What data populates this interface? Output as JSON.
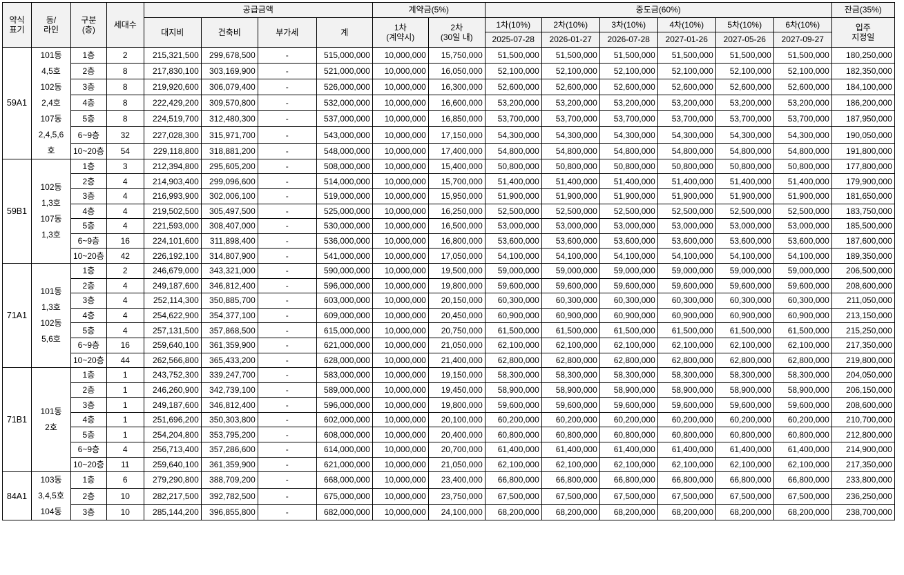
{
  "header": {
    "row1": {
      "type": "약식표기",
      "dong": "동/라인",
      "floor": "구분(층)",
      "units": "세대수",
      "supply": "공급금액",
      "contract": "계약금(5%)",
      "middle": "중도금(60%)",
      "balance": "잔금(35%)"
    },
    "type_lines": [
      "약식",
      "표기"
    ],
    "dong_lines": [
      "동/",
      "라인"
    ],
    "floor_lines": [
      "구분",
      "(층)"
    ],
    "supply_cols": [
      "대지비",
      "건축비",
      "부가세",
      "계"
    ],
    "contract_cols": [
      {
        "label": "1차",
        "sub": "(계약시)"
      },
      {
        "label": "2차",
        "sub": "(30일 내)"
      }
    ],
    "middle_cols": [
      {
        "label": "1차(10%)",
        "date": "2025-07-28"
      },
      {
        "label": "2차(10%)",
        "date": "2026-01-27"
      },
      {
        "label": "3차(10%)",
        "date": "2026-07-28"
      },
      {
        "label": "4차(10%)",
        "date": "2027-01-26"
      },
      {
        "label": "5차(10%)",
        "date": "2027-05-26"
      },
      {
        "label": "6차(10%)",
        "date": "2027-09-27"
      }
    ],
    "balance_col": {
      "label": "입주",
      "sub": "지정일"
    }
  },
  "groups": [
    {
      "type": "59A1",
      "dong": [
        "101동",
        "4,5호",
        "102동",
        "2,4호",
        "107동",
        "2,4,5,6",
        "호"
      ],
      "rows": [
        {
          "floor": "1층",
          "units": "2",
          "land": "215,321,500",
          "build": "299,678,500",
          "vat": "-",
          "total": "515,000,000",
          "c1": "10,000,000",
          "c2": "15,750,000",
          "m": [
            "51,500,000",
            "51,500,000",
            "51,500,000",
            "51,500,000",
            "51,500,000",
            "51,500,000"
          ],
          "bal": "180,250,000"
        },
        {
          "floor": "2층",
          "units": "8",
          "land": "217,830,100",
          "build": "303,169,900",
          "vat": "-",
          "total": "521,000,000",
          "c1": "10,000,000",
          "c2": "16,050,000",
          "m": [
            "52,100,000",
            "52,100,000",
            "52,100,000",
            "52,100,000",
            "52,100,000",
            "52,100,000"
          ],
          "bal": "182,350,000"
        },
        {
          "floor": "3층",
          "units": "8",
          "land": "219,920,600",
          "build": "306,079,400",
          "vat": "-",
          "total": "526,000,000",
          "c1": "10,000,000",
          "c2": "16,300,000",
          "m": [
            "52,600,000",
            "52,600,000",
            "52,600,000",
            "52,600,000",
            "52,600,000",
            "52,600,000"
          ],
          "bal": "184,100,000"
        },
        {
          "floor": "4층",
          "units": "8",
          "land": "222,429,200",
          "build": "309,570,800",
          "vat": "-",
          "total": "532,000,000",
          "c1": "10,000,000",
          "c2": "16,600,000",
          "m": [
            "53,200,000",
            "53,200,000",
            "53,200,000",
            "53,200,000",
            "53,200,000",
            "53,200,000"
          ],
          "bal": "186,200,000"
        },
        {
          "floor": "5층",
          "units": "8",
          "land": "224,519,700",
          "build": "312,480,300",
          "vat": "-",
          "total": "537,000,000",
          "c1": "10,000,000",
          "c2": "16,850,000",
          "m": [
            "53,700,000",
            "53,700,000",
            "53,700,000",
            "53,700,000",
            "53,700,000",
            "53,700,000"
          ],
          "bal": "187,950,000"
        },
        {
          "floor": "6~9층",
          "units": "32",
          "land": "227,028,300",
          "build": "315,971,700",
          "vat": "-",
          "total": "543,000,000",
          "c1": "10,000,000",
          "c2": "17,150,000",
          "m": [
            "54,300,000",
            "54,300,000",
            "54,300,000",
            "54,300,000",
            "54,300,000",
            "54,300,000"
          ],
          "bal": "190,050,000"
        },
        {
          "floor": "10~20층",
          "units": "54",
          "land": "229,118,800",
          "build": "318,881,200",
          "vat": "-",
          "total": "548,000,000",
          "c1": "10,000,000",
          "c2": "17,400,000",
          "m": [
            "54,800,000",
            "54,800,000",
            "54,800,000",
            "54,800,000",
            "54,800,000",
            "54,800,000"
          ],
          "bal": "191,800,000"
        }
      ]
    },
    {
      "type": "59B1",
      "dong": [
        "102동",
        "1,3호",
        "107동",
        "1,3호"
      ],
      "rows": [
        {
          "floor": "1층",
          "units": "3",
          "land": "212,394,800",
          "build": "295,605,200",
          "vat": "-",
          "total": "508,000,000",
          "c1": "10,000,000",
          "c2": "15,400,000",
          "m": [
            "50,800,000",
            "50,800,000",
            "50,800,000",
            "50,800,000",
            "50,800,000",
            "50,800,000"
          ],
          "bal": "177,800,000"
        },
        {
          "floor": "2층",
          "units": "4",
          "land": "214,903,400",
          "build": "299,096,600",
          "vat": "-",
          "total": "514,000,000",
          "c1": "10,000,000",
          "c2": "15,700,000",
          "m": [
            "51,400,000",
            "51,400,000",
            "51,400,000",
            "51,400,000",
            "51,400,000",
            "51,400,000"
          ],
          "bal": "179,900,000"
        },
        {
          "floor": "3층",
          "units": "4",
          "land": "216,993,900",
          "build": "302,006,100",
          "vat": "-",
          "total": "519,000,000",
          "c1": "10,000,000",
          "c2": "15,950,000",
          "m": [
            "51,900,000",
            "51,900,000",
            "51,900,000",
            "51,900,000",
            "51,900,000",
            "51,900,000"
          ],
          "bal": "181,650,000"
        },
        {
          "floor": "4층",
          "units": "4",
          "land": "219,502,500",
          "build": "305,497,500",
          "vat": "-",
          "total": "525,000,000",
          "c1": "10,000,000",
          "c2": "16,250,000",
          "m": [
            "52,500,000",
            "52,500,000",
            "52,500,000",
            "52,500,000",
            "52,500,000",
            "52,500,000"
          ],
          "bal": "183,750,000"
        },
        {
          "floor": "5층",
          "units": "4",
          "land": "221,593,000",
          "build": "308,407,000",
          "vat": "-",
          "total": "530,000,000",
          "c1": "10,000,000",
          "c2": "16,500,000",
          "m": [
            "53,000,000",
            "53,000,000",
            "53,000,000",
            "53,000,000",
            "53,000,000",
            "53,000,000"
          ],
          "bal": "185,500,000"
        },
        {
          "floor": "6~9층",
          "units": "16",
          "land": "224,101,600",
          "build": "311,898,400",
          "vat": "-",
          "total": "536,000,000",
          "c1": "10,000,000",
          "c2": "16,800,000",
          "m": [
            "53,600,000",
            "53,600,000",
            "53,600,000",
            "53,600,000",
            "53,600,000",
            "53,600,000"
          ],
          "bal": "187,600,000"
        },
        {
          "floor": "10~20층",
          "units": "42",
          "land": "226,192,100",
          "build": "314,807,900",
          "vat": "-",
          "total": "541,000,000",
          "c1": "10,000,000",
          "c2": "17,050,000",
          "m": [
            "54,100,000",
            "54,100,000",
            "54,100,000",
            "54,100,000",
            "54,100,000",
            "54,100,000"
          ],
          "bal": "189,350,000"
        }
      ]
    },
    {
      "type": "71A1",
      "dong": [
        "101동",
        "1,3호",
        "102동",
        "5,6호"
      ],
      "rows": [
        {
          "floor": "1층",
          "units": "2",
          "land": "246,679,000",
          "build": "343,321,000",
          "vat": "-",
          "total": "590,000,000",
          "c1": "10,000,000",
          "c2": "19,500,000",
          "m": [
            "59,000,000",
            "59,000,000",
            "59,000,000",
            "59,000,000",
            "59,000,000",
            "59,000,000"
          ],
          "bal": "206,500,000"
        },
        {
          "floor": "2층",
          "units": "4",
          "land": "249,187,600",
          "build": "346,812,400",
          "vat": "-",
          "total": "596,000,000",
          "c1": "10,000,000",
          "c2": "19,800,000",
          "m": [
            "59,600,000",
            "59,600,000",
            "59,600,000",
            "59,600,000",
            "59,600,000",
            "59,600,000"
          ],
          "bal": "208,600,000"
        },
        {
          "floor": "3층",
          "units": "4",
          "land": "252,114,300",
          "build": "350,885,700",
          "vat": "-",
          "total": "603,000,000",
          "c1": "10,000,000",
          "c2": "20,150,000",
          "m": [
            "60,300,000",
            "60,300,000",
            "60,300,000",
            "60,300,000",
            "60,300,000",
            "60,300,000"
          ],
          "bal": "211,050,000"
        },
        {
          "floor": "4층",
          "units": "4",
          "land": "254,622,900",
          "build": "354,377,100",
          "vat": "-",
          "total": "609,000,000",
          "c1": "10,000,000",
          "c2": "20,450,000",
          "m": [
            "60,900,000",
            "60,900,000",
            "60,900,000",
            "60,900,000",
            "60,900,000",
            "60,900,000"
          ],
          "bal": "213,150,000"
        },
        {
          "floor": "5층",
          "units": "4",
          "land": "257,131,500",
          "build": "357,868,500",
          "vat": "-",
          "total": "615,000,000",
          "c1": "10,000,000",
          "c2": "20,750,000",
          "m": [
            "61,500,000",
            "61,500,000",
            "61,500,000",
            "61,500,000",
            "61,500,000",
            "61,500,000"
          ],
          "bal": "215,250,000"
        },
        {
          "floor": "6~9층",
          "units": "16",
          "land": "259,640,100",
          "build": "361,359,900",
          "vat": "-",
          "total": "621,000,000",
          "c1": "10,000,000",
          "c2": "21,050,000",
          "m": [
            "62,100,000",
            "62,100,000",
            "62,100,000",
            "62,100,000",
            "62,100,000",
            "62,100,000"
          ],
          "bal": "217,350,000"
        },
        {
          "floor": "10~20층",
          "units": "44",
          "land": "262,566,800",
          "build": "365,433,200",
          "vat": "-",
          "total": "628,000,000",
          "c1": "10,000,000",
          "c2": "21,400,000",
          "m": [
            "62,800,000",
            "62,800,000",
            "62,800,000",
            "62,800,000",
            "62,800,000",
            "62,800,000"
          ],
          "bal": "219,800,000"
        }
      ]
    },
    {
      "type": "71B1",
      "dong": [
        "101동",
        "2호"
      ],
      "rows": [
        {
          "floor": "1층",
          "units": "1",
          "land": "243,752,300",
          "build": "339,247,700",
          "vat": "-",
          "total": "583,000,000",
          "c1": "10,000,000",
          "c2": "19,150,000",
          "m": [
            "58,300,000",
            "58,300,000",
            "58,300,000",
            "58,300,000",
            "58,300,000",
            "58,300,000"
          ],
          "bal": "204,050,000"
        },
        {
          "floor": "2층",
          "units": "1",
          "land": "246,260,900",
          "build": "342,739,100",
          "vat": "-",
          "total": "589,000,000",
          "c1": "10,000,000",
          "c2": "19,450,000",
          "m": [
            "58,900,000",
            "58,900,000",
            "58,900,000",
            "58,900,000",
            "58,900,000",
            "58,900,000"
          ],
          "bal": "206,150,000"
        },
        {
          "floor": "3층",
          "units": "1",
          "land": "249,187,600",
          "build": "346,812,400",
          "vat": "-",
          "total": "596,000,000",
          "c1": "10,000,000",
          "c2": "19,800,000",
          "m": [
            "59,600,000",
            "59,600,000",
            "59,600,000",
            "59,600,000",
            "59,600,000",
            "59,600,000"
          ],
          "bal": "208,600,000"
        },
        {
          "floor": "4층",
          "units": "1",
          "land": "251,696,200",
          "build": "350,303,800",
          "vat": "-",
          "total": "602,000,000",
          "c1": "10,000,000",
          "c2": "20,100,000",
          "m": [
            "60,200,000",
            "60,200,000",
            "60,200,000",
            "60,200,000",
            "60,200,000",
            "60,200,000"
          ],
          "bal": "210,700,000"
        },
        {
          "floor": "5층",
          "units": "1",
          "land": "254,204,800",
          "build": "353,795,200",
          "vat": "-",
          "total": "608,000,000",
          "c1": "10,000,000",
          "c2": "20,400,000",
          "m": [
            "60,800,000",
            "60,800,000",
            "60,800,000",
            "60,800,000",
            "60,800,000",
            "60,800,000"
          ],
          "bal": "212,800,000"
        },
        {
          "floor": "6~9층",
          "units": "4",
          "land": "256,713,400",
          "build": "357,286,600",
          "vat": "-",
          "total": "614,000,000",
          "c1": "10,000,000",
          "c2": "20,700,000",
          "m": [
            "61,400,000",
            "61,400,000",
            "61,400,000",
            "61,400,000",
            "61,400,000",
            "61,400,000"
          ],
          "bal": "214,900,000"
        },
        {
          "floor": "10~20층",
          "units": "11",
          "land": "259,640,100",
          "build": "361,359,900",
          "vat": "-",
          "total": "621,000,000",
          "c1": "10,000,000",
          "c2": "21,050,000",
          "m": [
            "62,100,000",
            "62,100,000",
            "62,100,000",
            "62,100,000",
            "62,100,000",
            "62,100,000"
          ],
          "bal": "217,350,000"
        }
      ]
    },
    {
      "type": "84A1",
      "dong": [
        "103동",
        "3,4,5호",
        "104동"
      ],
      "rows": [
        {
          "floor": "1층",
          "units": "6",
          "land": "279,290,800",
          "build": "388,709,200",
          "vat": "-",
          "total": "668,000,000",
          "c1": "10,000,000",
          "c2": "23,400,000",
          "m": [
            "66,800,000",
            "66,800,000",
            "66,800,000",
            "66,800,000",
            "66,800,000",
            "66,800,000"
          ],
          "bal": "233,800,000"
        },
        {
          "floor": "2층",
          "units": "10",
          "land": "282,217,500",
          "build": "392,782,500",
          "vat": "-",
          "total": "675,000,000",
          "c1": "10,000,000",
          "c2": "23,750,000",
          "m": [
            "67,500,000",
            "67,500,000",
            "67,500,000",
            "67,500,000",
            "67,500,000",
            "67,500,000"
          ],
          "bal": "236,250,000"
        },
        {
          "floor": "3층",
          "units": "10",
          "land": "285,144,200",
          "build": "396,855,800",
          "vat": "-",
          "total": "682,000,000",
          "c1": "10,000,000",
          "c2": "24,100,000",
          "m": [
            "68,200,000",
            "68,200,000",
            "68,200,000",
            "68,200,000",
            "68,200,000",
            "68,200,000"
          ],
          "bal": "238,700,000"
        }
      ]
    }
  ]
}
